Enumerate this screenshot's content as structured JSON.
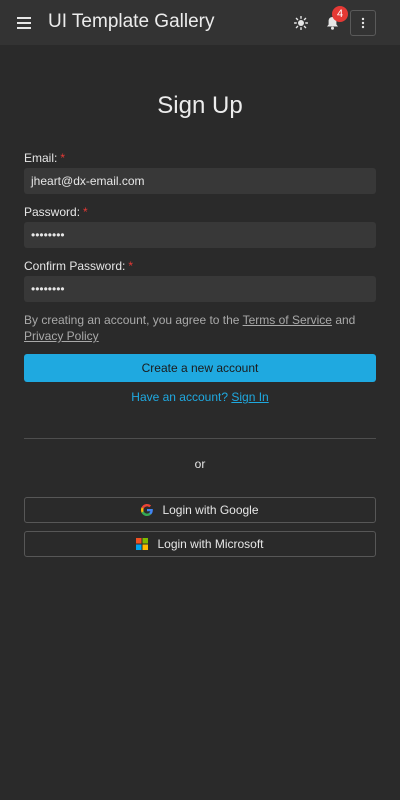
{
  "header": {
    "title": "UI Template Gallery",
    "notification_count": "4"
  },
  "form": {
    "title": "Sign Up",
    "email_label": "Email:",
    "email_value": "jheart@dx-email.com",
    "password_label": "Password:",
    "password_value": "••••••••",
    "confirm_label": "Confirm Password:",
    "confirm_value": "••••••••",
    "required_mark": "*",
    "terms_prefix": "By creating an account, you agree to the",
    "terms_link": "Terms of Service",
    "terms_and": "and",
    "privacy_link": "Privacy Policy",
    "submit_label": "Create a new account",
    "have_account": "Have an account?",
    "signin_link": "Sign In"
  },
  "social": {
    "or": "or",
    "google_label": "Login with Google",
    "microsoft_label": "Login with Microsoft"
  },
  "colors": {
    "accent": "#1fa9e0",
    "background": "#2a2a2a",
    "header": "#333333",
    "badge": "#e53935",
    "required": "#e53935"
  },
  "icons": [
    "menu-icon",
    "sun-icon",
    "bell-icon",
    "more-vertical-icon",
    "google-icon",
    "microsoft-icon"
  ]
}
